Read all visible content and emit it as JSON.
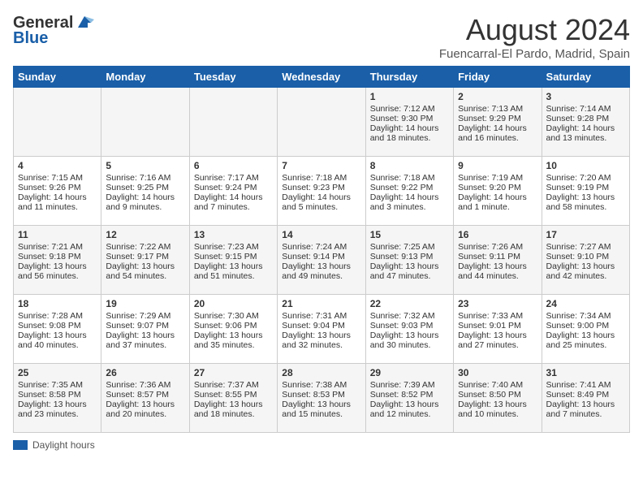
{
  "header": {
    "logo_general": "General",
    "logo_blue": "Blue",
    "month_title": "August 2024",
    "location": "Fuencarral-El Pardo, Madrid, Spain"
  },
  "weekdays": [
    "Sunday",
    "Monday",
    "Tuesday",
    "Wednesday",
    "Thursday",
    "Friday",
    "Saturday"
  ],
  "weeks": [
    [
      {
        "day": "",
        "content": ""
      },
      {
        "day": "",
        "content": ""
      },
      {
        "day": "",
        "content": ""
      },
      {
        "day": "",
        "content": ""
      },
      {
        "day": "1",
        "content": "Sunrise: 7:12 AM\nSunset: 9:30 PM\nDaylight: 14 hours and 18 minutes."
      },
      {
        "day": "2",
        "content": "Sunrise: 7:13 AM\nSunset: 9:29 PM\nDaylight: 14 hours and 16 minutes."
      },
      {
        "day": "3",
        "content": "Sunrise: 7:14 AM\nSunset: 9:28 PM\nDaylight: 14 hours and 13 minutes."
      }
    ],
    [
      {
        "day": "4",
        "content": "Sunrise: 7:15 AM\nSunset: 9:26 PM\nDaylight: 14 hours and 11 minutes."
      },
      {
        "day": "5",
        "content": "Sunrise: 7:16 AM\nSunset: 9:25 PM\nDaylight: 14 hours and 9 minutes."
      },
      {
        "day": "6",
        "content": "Sunrise: 7:17 AM\nSunset: 9:24 PM\nDaylight: 14 hours and 7 minutes."
      },
      {
        "day": "7",
        "content": "Sunrise: 7:18 AM\nSunset: 9:23 PM\nDaylight: 14 hours and 5 minutes."
      },
      {
        "day": "8",
        "content": "Sunrise: 7:18 AM\nSunset: 9:22 PM\nDaylight: 14 hours and 3 minutes."
      },
      {
        "day": "9",
        "content": "Sunrise: 7:19 AM\nSunset: 9:20 PM\nDaylight: 14 hours and 1 minute."
      },
      {
        "day": "10",
        "content": "Sunrise: 7:20 AM\nSunset: 9:19 PM\nDaylight: 13 hours and 58 minutes."
      }
    ],
    [
      {
        "day": "11",
        "content": "Sunrise: 7:21 AM\nSunset: 9:18 PM\nDaylight: 13 hours and 56 minutes."
      },
      {
        "day": "12",
        "content": "Sunrise: 7:22 AM\nSunset: 9:17 PM\nDaylight: 13 hours and 54 minutes."
      },
      {
        "day": "13",
        "content": "Sunrise: 7:23 AM\nSunset: 9:15 PM\nDaylight: 13 hours and 51 minutes."
      },
      {
        "day": "14",
        "content": "Sunrise: 7:24 AM\nSunset: 9:14 PM\nDaylight: 13 hours and 49 minutes."
      },
      {
        "day": "15",
        "content": "Sunrise: 7:25 AM\nSunset: 9:13 PM\nDaylight: 13 hours and 47 minutes."
      },
      {
        "day": "16",
        "content": "Sunrise: 7:26 AM\nSunset: 9:11 PM\nDaylight: 13 hours and 44 minutes."
      },
      {
        "day": "17",
        "content": "Sunrise: 7:27 AM\nSunset: 9:10 PM\nDaylight: 13 hours and 42 minutes."
      }
    ],
    [
      {
        "day": "18",
        "content": "Sunrise: 7:28 AM\nSunset: 9:08 PM\nDaylight: 13 hours and 40 minutes."
      },
      {
        "day": "19",
        "content": "Sunrise: 7:29 AM\nSunset: 9:07 PM\nDaylight: 13 hours and 37 minutes."
      },
      {
        "day": "20",
        "content": "Sunrise: 7:30 AM\nSunset: 9:06 PM\nDaylight: 13 hours and 35 minutes."
      },
      {
        "day": "21",
        "content": "Sunrise: 7:31 AM\nSunset: 9:04 PM\nDaylight: 13 hours and 32 minutes."
      },
      {
        "day": "22",
        "content": "Sunrise: 7:32 AM\nSunset: 9:03 PM\nDaylight: 13 hours and 30 minutes."
      },
      {
        "day": "23",
        "content": "Sunrise: 7:33 AM\nSunset: 9:01 PM\nDaylight: 13 hours and 27 minutes."
      },
      {
        "day": "24",
        "content": "Sunrise: 7:34 AM\nSunset: 9:00 PM\nDaylight: 13 hours and 25 minutes."
      }
    ],
    [
      {
        "day": "25",
        "content": "Sunrise: 7:35 AM\nSunset: 8:58 PM\nDaylight: 13 hours and 23 minutes."
      },
      {
        "day": "26",
        "content": "Sunrise: 7:36 AM\nSunset: 8:57 PM\nDaylight: 13 hours and 20 minutes."
      },
      {
        "day": "27",
        "content": "Sunrise: 7:37 AM\nSunset: 8:55 PM\nDaylight: 13 hours and 18 minutes."
      },
      {
        "day": "28",
        "content": "Sunrise: 7:38 AM\nSunset: 8:53 PM\nDaylight: 13 hours and 15 minutes."
      },
      {
        "day": "29",
        "content": "Sunrise: 7:39 AM\nSunset: 8:52 PM\nDaylight: 13 hours and 12 minutes."
      },
      {
        "day": "30",
        "content": "Sunrise: 7:40 AM\nSunset: 8:50 PM\nDaylight: 13 hours and 10 minutes."
      },
      {
        "day": "31",
        "content": "Sunrise: 7:41 AM\nSunset: 8:49 PM\nDaylight: 13 hours and 7 minutes."
      }
    ]
  ],
  "legend": {
    "daylight_label": "Daylight hours"
  }
}
